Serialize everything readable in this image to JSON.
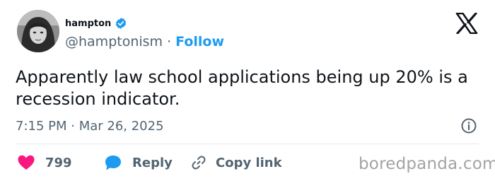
{
  "author": {
    "display_name": "hampton",
    "handle": "@hamptonism",
    "separator": "·",
    "follow_label": "Follow"
  },
  "tweet": {
    "text": "Apparently law school applications being up 20% is a recession indicator.",
    "timestamp": "7:15 PM · Mar 26, 2025"
  },
  "actions": {
    "like_count": "799",
    "reply_label": "Reply",
    "copy_link_label": "Copy link"
  },
  "watermark": "boredpanda.com",
  "colors": {
    "accent": "#1d9bf0",
    "like": "#f91880",
    "muted": "#536471",
    "text": "#0f1419"
  },
  "icons": {
    "verified": "verified-badge-icon",
    "brand": "x-logo-icon",
    "info": "info-icon",
    "like": "heart-icon",
    "reply": "reply-bubble-icon",
    "copy_link": "link-icon"
  }
}
